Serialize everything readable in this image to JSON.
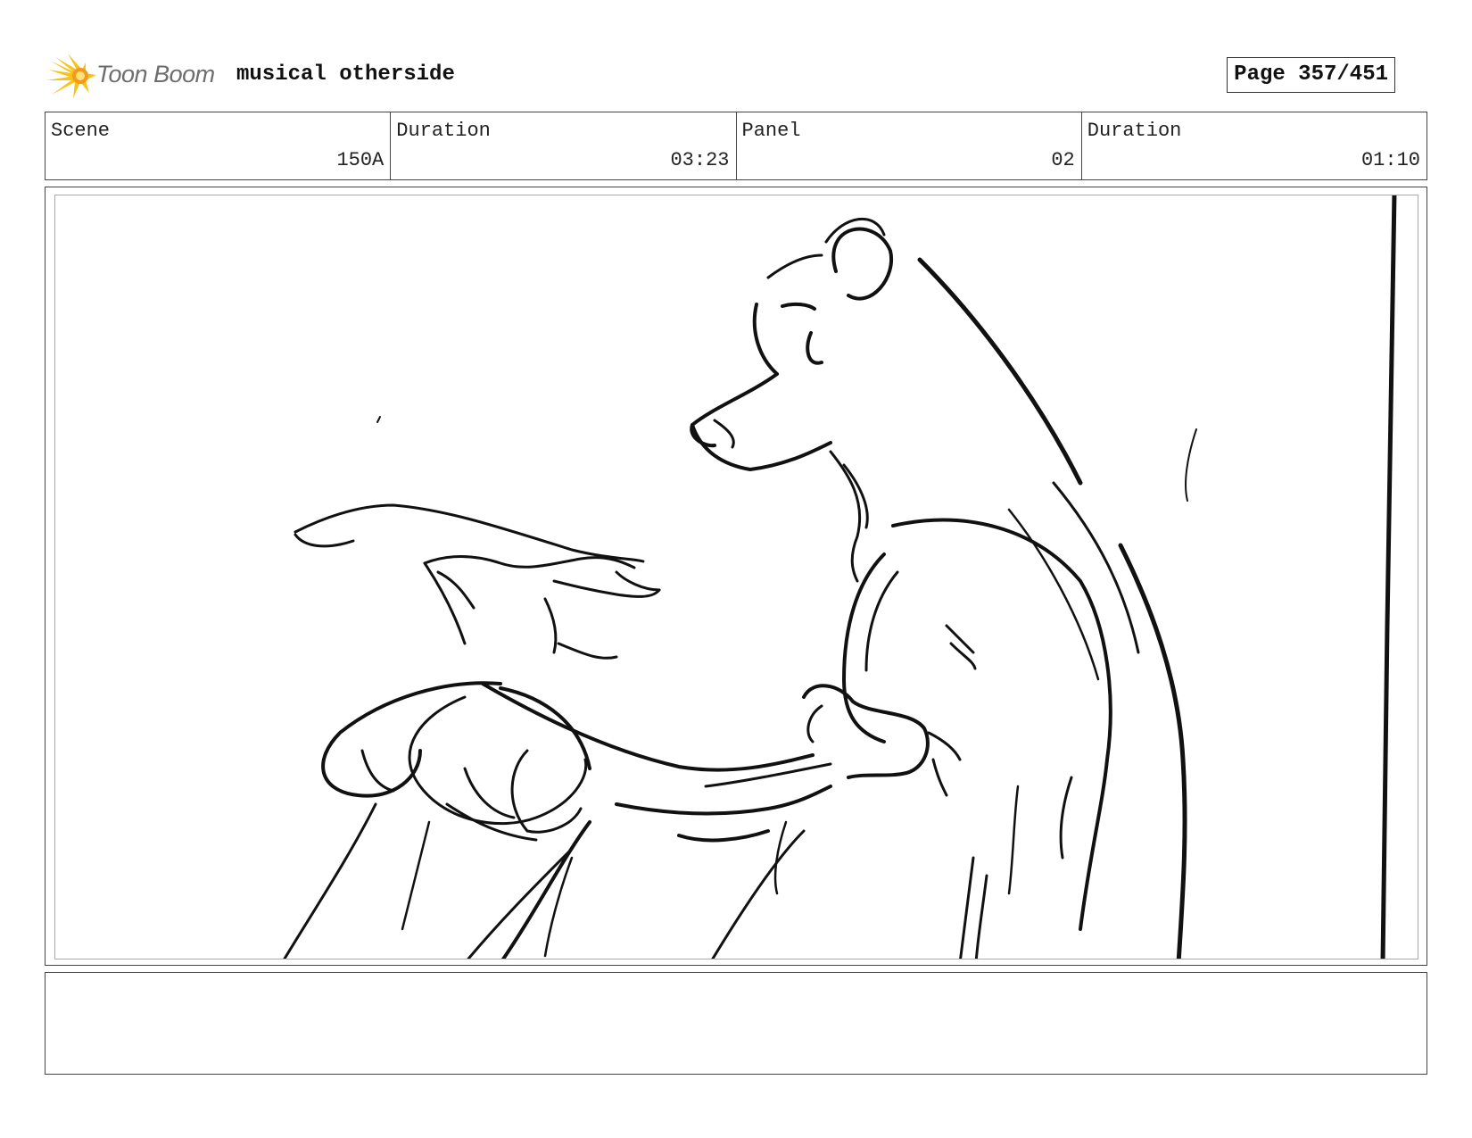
{
  "header": {
    "logo_text": "Toon Boom",
    "project_title": "musical otherside",
    "page_label": "Page 357/451"
  },
  "info": {
    "scene": {
      "label": "Scene",
      "value": "150A"
    },
    "scene_duration": {
      "label": "Duration",
      "value": "03:23"
    },
    "panel": {
      "label": "Panel",
      "value": "02"
    },
    "panel_duration": {
      "label": "Duration",
      "value": "01:10"
    }
  },
  "panel_image": {
    "icon": "storyboard-sketch"
  },
  "notes": {
    "text": ""
  },
  "colors": {
    "logo_yellow": "#f7c21a",
    "logo_orange": "#f39a1e",
    "logo_text": "#6d6d6d",
    "border": "#444444",
    "inner_border": "#aaaaaa"
  }
}
